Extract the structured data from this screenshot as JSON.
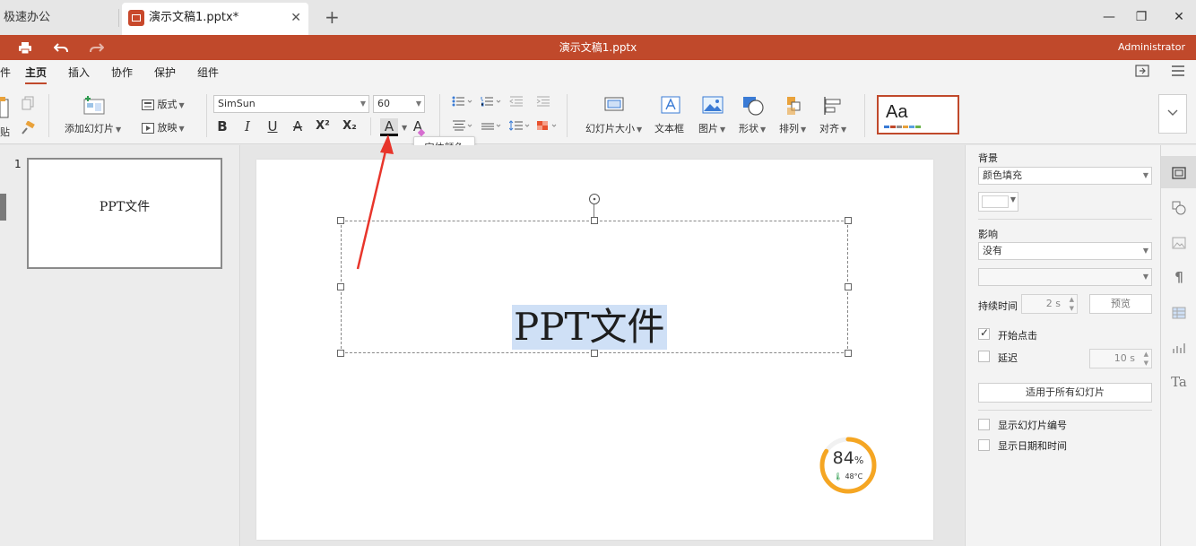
{
  "tabs": {
    "home_label": "极速办公",
    "doc_label": "演示文稿1.pptx*",
    "close_glyph": "✕",
    "new_glyph": "+"
  },
  "window": {
    "minimize": "—",
    "maximize": "❐",
    "close": "✕"
  },
  "titlebar": {
    "title": "演示文稿1.pptx",
    "user": "Administrator",
    "accent": "#c0492b"
  },
  "menu": {
    "items": [
      "件",
      "主页",
      "插入",
      "协作",
      "保护",
      "组件"
    ],
    "active": "主页"
  },
  "ribbon": {
    "paste_label": "贴",
    "add_slide": "添加幻灯片",
    "layout": "版式",
    "play": "放映",
    "font_name": "SimSun",
    "font_size": "60",
    "bold": "B",
    "italic": "I",
    "underline": "U",
    "strike": "A",
    "superscript": "X²",
    "subscript": "X₂",
    "font_color": "A",
    "highlight": "A",
    "slide_size": "幻灯片大小",
    "textbox": "文本框",
    "picture": "图片",
    "shape": "形状",
    "arrange": "排列",
    "align": "对齐",
    "theme_preview": "Aa"
  },
  "tooltip": {
    "text": "字体颜色"
  },
  "slides": {
    "items": [
      {
        "number": "1",
        "text": "PPT文件"
      }
    ]
  },
  "slide": {
    "main_text": "PPT文件"
  },
  "gauge": {
    "value": "84",
    "unit": "%",
    "temp": "48°C",
    "percent": 0.84,
    "color": "#f5a623"
  },
  "panel": {
    "background_label": "背景",
    "background_fill": "颜色填充",
    "effect_label": "影响",
    "effect_value": "没有",
    "duration_label": "持续时间",
    "duration_value": "2 s",
    "preview_button": "预览",
    "start_on_click": "开始点击",
    "delay_label": "延迟",
    "delay_value": "10 s",
    "apply_all": "适用于所有幻灯片",
    "show_slide_number": "显示幻灯片编号",
    "show_date_time": "显示日期和时间"
  }
}
